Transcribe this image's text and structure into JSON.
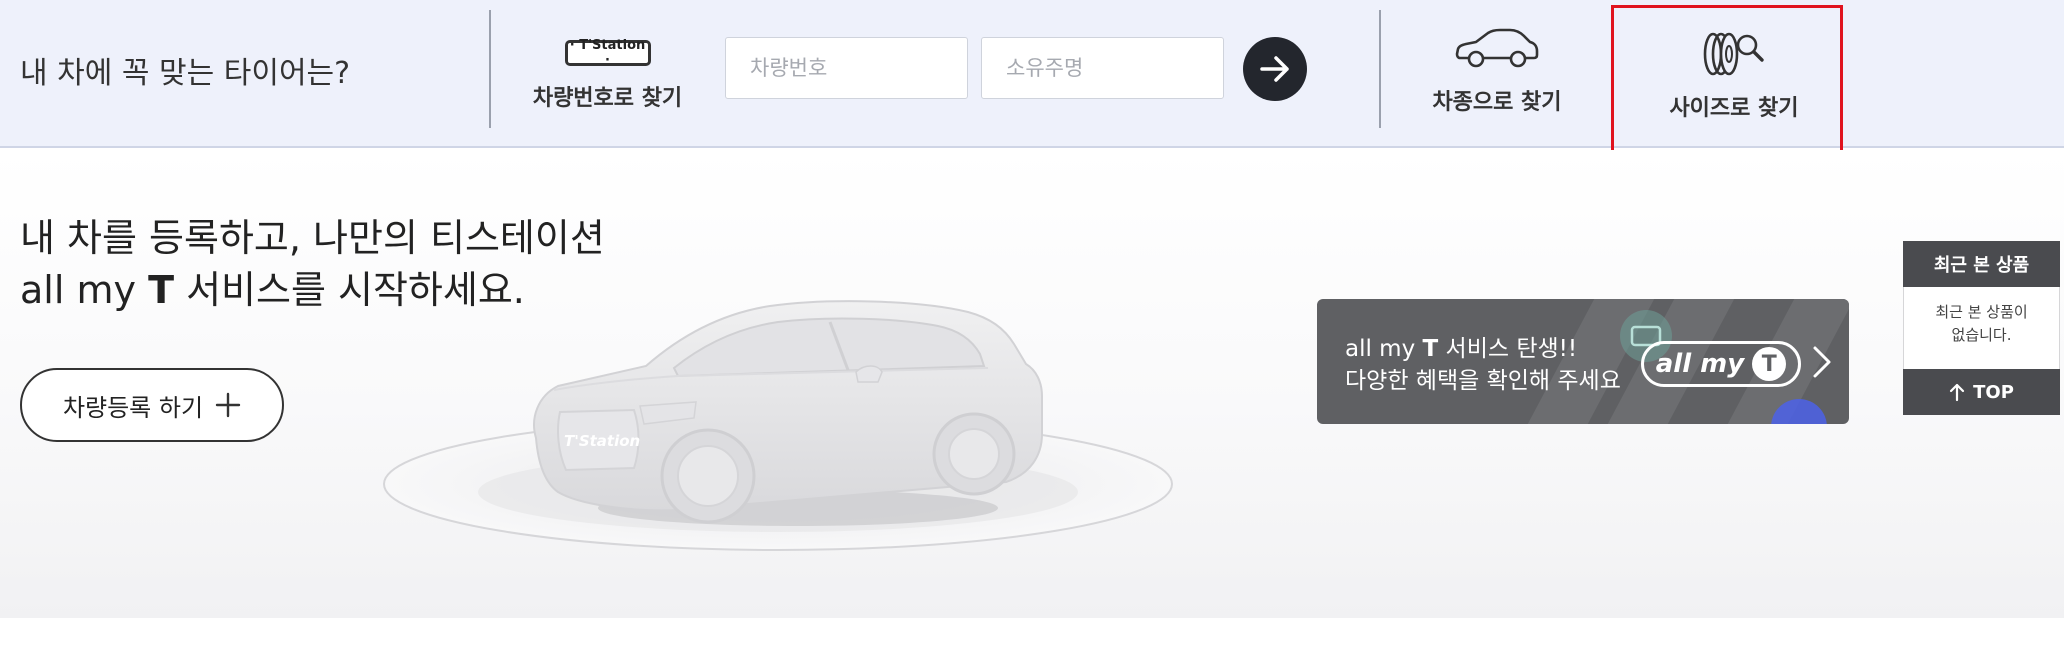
{
  "search_bar": {
    "question": "내 차에 꼭 맞는 타이어는?",
    "plate_search": {
      "icon_text": "· T'Station ·",
      "label": "차량번호로 찾기",
      "car_number_placeholder": "차량번호",
      "owner_name_placeholder": "소유주명"
    },
    "model_search_label": "차종으로 찾기",
    "size_search_label": "사이즈로 찾기"
  },
  "hero": {
    "title_line1": "내 차를 등록하고, 나만의 티스테이션",
    "title_line2_prefix": "all my ",
    "title_line2_bold": "T",
    "title_line2_suffix": " 서비스를 시작하세요.",
    "register_button_label": "차량등록 하기",
    "car_badge": "T'Station"
  },
  "banner": {
    "line1_prefix": "all my ",
    "line1_bold": "T",
    "line1_suffix": " 서비스 탄생!!",
    "line2": "다양한 혜택을 확인해 주세요",
    "logo_text": "all my",
    "logo_letter": "T"
  },
  "recent_products": {
    "title": "최근 본 상품",
    "empty_line1": "최근 본 상품이",
    "empty_line2": "없습니다.",
    "top_label": "TOP"
  },
  "colors": {
    "topbar_bg": "#eef1fb",
    "highlight": "#e0131e",
    "dark": "#23262d",
    "banner_bg": "#5f6063",
    "widget_dark": "#4a4b4f"
  }
}
